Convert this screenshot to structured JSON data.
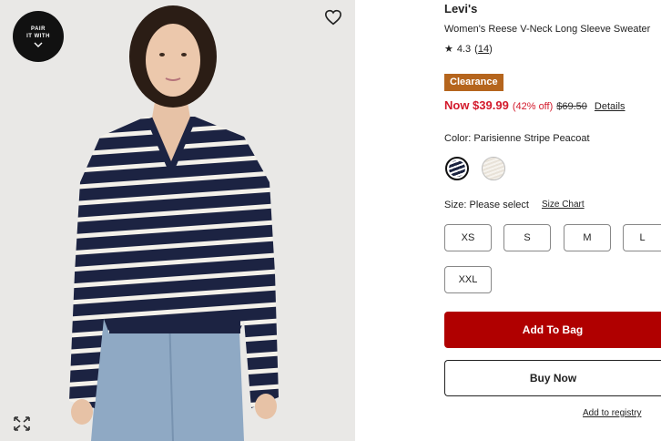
{
  "badge": {
    "line1": "PAIR",
    "line2": "IT WITH"
  },
  "product": {
    "brand": "Levi's",
    "name": "Women's Reese V-Neck Long Sleeve Sweater",
    "rating": "4.3",
    "review_count": "14",
    "badge": "Clearance",
    "price_now": "Now $39.99",
    "discount": "(42% off)",
    "price_was": "$69.50",
    "details_link": "Details"
  },
  "color": {
    "label": "Color:",
    "value": "Parisienne Stripe Peacoat"
  },
  "size": {
    "label": "Size:",
    "value": "Please select",
    "chart_link": "Size Chart",
    "options": [
      "XS",
      "S",
      "M",
      "L",
      "XXL"
    ]
  },
  "actions": {
    "add_to_bag": "Add To Bag",
    "buy_now": "Buy Now",
    "registry": "Add to registry"
  },
  "colors": {
    "clearance_bg": "#b5651d",
    "sale_red": "#d31a2c",
    "add_to_bag_bg": "#b00000",
    "stripe_navy": "#1b2340"
  }
}
